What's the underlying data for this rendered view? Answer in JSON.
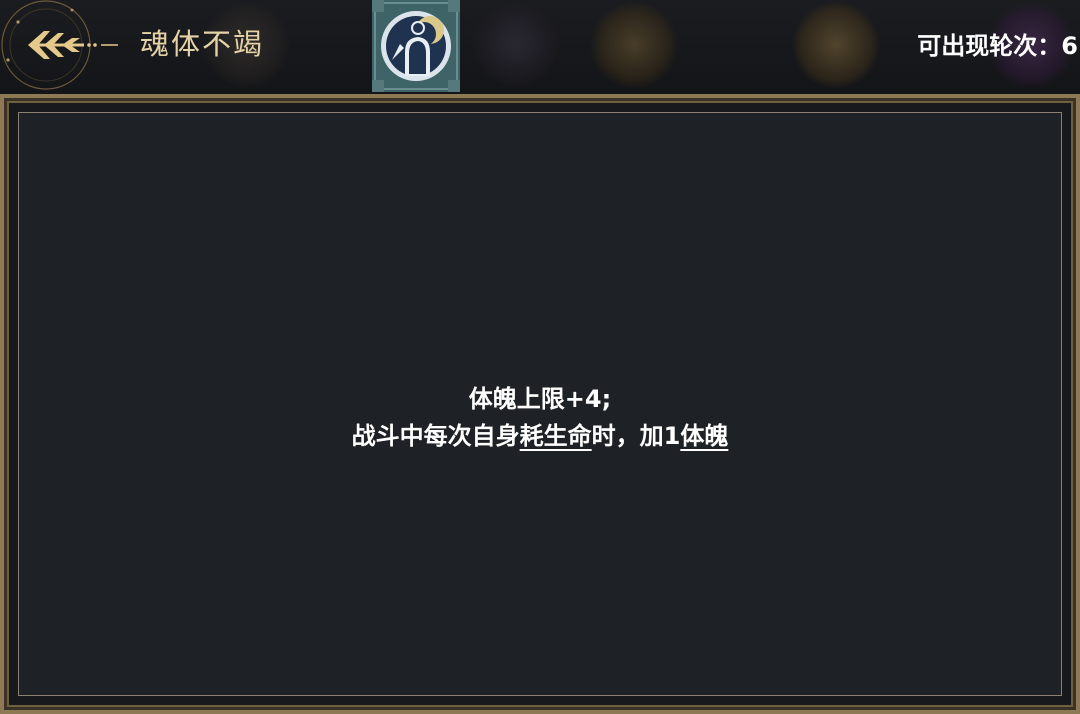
{
  "header": {
    "title": "魂体不竭",
    "rounds_label": "可出现轮次：6"
  },
  "icons": {
    "back": "back-arrow-icon",
    "talent": "talent-silhouette-icon"
  },
  "description": {
    "line1": "体魄上限+4;",
    "line2_pre": "战斗中每次自身",
    "line2_kw1": "耗生命",
    "line2_mid": "时，加1",
    "line2_kw2": "体魄"
  },
  "colors": {
    "title_gold": "#e4d2a6",
    "frame_gold": "#8d7a55",
    "panel_bg": "#1e2125",
    "text": "#ffffff"
  }
}
